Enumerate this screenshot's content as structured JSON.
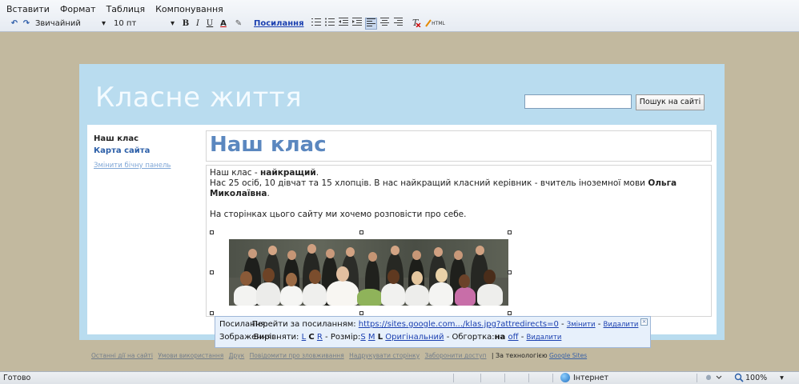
{
  "menu": {
    "items": [
      "Вставити",
      "Формат",
      "Таблиця",
      "Компонування"
    ]
  },
  "toolbar": {
    "undo_icon": "↶",
    "redo_icon": "↷",
    "style_value": "Звичайний",
    "size_value": "10 пт",
    "bold": "B",
    "italic": "I",
    "underline": "U",
    "font_color": "A",
    "highlight": "✎",
    "link_label": "Посилання",
    "align_left_glyph": "≡",
    "html_label": "HTML",
    "dropdown_arrow": "▾"
  },
  "site": {
    "title": "Класне життя",
    "search_placeholder": "",
    "search_button": "Пошук на сайті",
    "nav": {
      "item1": "Наш клас",
      "item2": "Карта сайта",
      "item3": "Змінити бічну панель"
    },
    "page_title": "Наш клас",
    "body": {
      "p1_plain": "Наш клас - ",
      "p1_bold": "найкращий",
      "p1_end": ".",
      "p2_plain": "Нас 25 осіб, 10 дівчат та 15 хлопців. В нас найкращий класний керівник - вчитель іноземної мови ",
      "p2_bold": "Ольга Миколаївна",
      "p2_end": ".",
      "p3": "На сторінках цього сайту ми хочемо розповісти про себе."
    }
  },
  "bubble": {
    "row1_label": "Посилання:",
    "row1_goto": "Перейти за посиланням:",
    "row1_url": "https://sites.google.com.../klas.jpg?attredirects=0",
    "row1_change": "Змінити",
    "row1_delete": "Видалити",
    "row2_label": "Зображення:",
    "row2_align": "Вирівняти:",
    "row2_L": "L",
    "row2_C": "C",
    "row2_R": "R",
    "row2_size": "Розмір:",
    "row2_S": "S",
    "row2_M": "M",
    "row2_Lsize": "L",
    "row2_original": "Оригінальний",
    "row2_wrap": "Обгортка:",
    "row2_on": "на",
    "row2_off": "off",
    "row2_delete": "Видалити",
    "close": "×"
  },
  "footer": {
    "links": [
      "Останні дії на сайті",
      "Умови використання",
      "Друк",
      "Повідомити про зловживання",
      "Надрукувати сторінку",
      "Заборонити доступ"
    ],
    "tech_label": "Зa технологією",
    "tech_link": "Google Sites"
  },
  "status": {
    "text": "Готово",
    "zone": "Інтернет",
    "zoom": "100%",
    "dropdown": "▾"
  }
}
